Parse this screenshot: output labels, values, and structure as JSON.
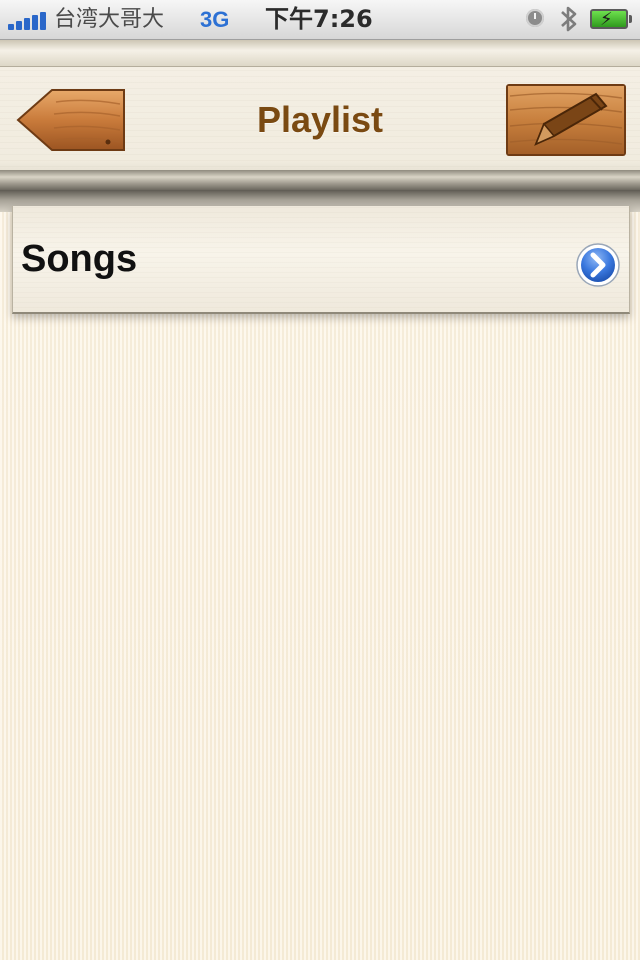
{
  "status_bar": {
    "carrier": "台湾大哥大",
    "network": "3G",
    "time": "下午7:26",
    "signal_bars": 5
  },
  "nav_bar": {
    "title": "Playlist",
    "back_icon": "wooden-arrow-left-icon",
    "edit_icon": "pencil-icon"
  },
  "list": {
    "items": [
      {
        "label": "Songs",
        "accessory_icon": "chevron-right-circle-icon"
      }
    ]
  },
  "colors": {
    "title": "#7a4a12",
    "accent_blue": "#2d71d4",
    "background": "#fbf3e3",
    "wood": "#c97b3b"
  }
}
